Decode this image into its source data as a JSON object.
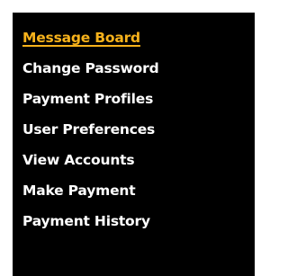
{
  "menu": {
    "items": [
      {
        "label": "Message Board",
        "active": true
      },
      {
        "label": "Change Password",
        "active": false
      },
      {
        "label": "Payment Profiles",
        "active": false
      },
      {
        "label": "User Preferences",
        "active": false
      },
      {
        "label": "View Accounts",
        "active": false
      },
      {
        "label": "Make Payment",
        "active": false
      },
      {
        "label": "Payment History",
        "active": false
      }
    ]
  },
  "colors": {
    "panel_background": "#000000",
    "link": "#ffffff",
    "active_link": "#f7b21b"
  }
}
